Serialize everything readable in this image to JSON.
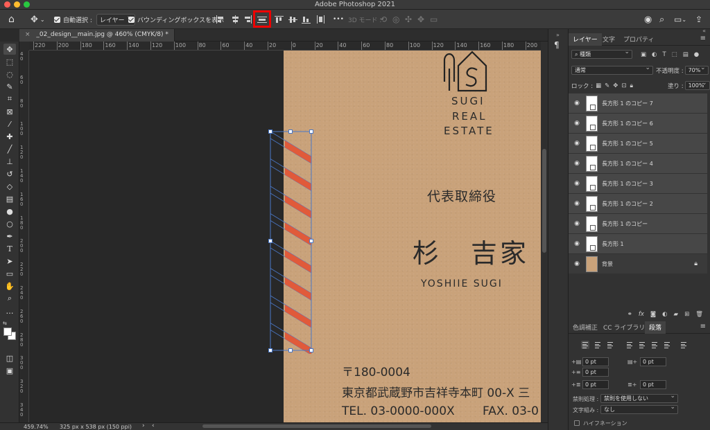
{
  "window": {
    "title": "Adobe Photoshop 2021"
  },
  "options_bar": {
    "auto_select_label": "自動選択 :",
    "auto_select_value": "レイヤー",
    "bounding_box_label": "バウンディングボックスを表示",
    "mode_3d_label": "3D モード :",
    "more_label": "•••"
  },
  "document": {
    "tab_title": "_02_design__main.jpg @ 460% (CMYK/8) *"
  },
  "ruler": {
    "h_labels": [
      "220",
      "200",
      "180",
      "160",
      "140",
      "120",
      "100",
      "80",
      "60",
      "40",
      "20",
      "0",
      "20",
      "40",
      "60",
      "80",
      "100",
      "120",
      "140",
      "160",
      "180",
      "200"
    ],
    "v_labels": [
      "4 0",
      "6 0",
      "8 0",
      "1 0 0",
      "1 2 0",
      "1 4 0",
      "1 6 0",
      "1 8 0",
      "2 0 0",
      "2 2 0",
      "2 4 0",
      "2 6 0",
      "2 8 0",
      "3 0 0",
      "3 2 0",
      "3 4 0"
    ]
  },
  "card": {
    "logo_line1": "SUGI",
    "logo_line2": "REAL",
    "logo_line3": "ESTATE",
    "role": "代表取締役",
    "name": "杉　吉家",
    "name_romaji": "YOSHIIE SUGI",
    "postal": "〒180-0004",
    "address": "東京都武蔵野市吉祥寺本町 00-X 三",
    "tel": "TEL. 03-0000-000X",
    "fax": "FAX. 03-0",
    "stripe_color": "#e05a3a",
    "background_color": "#c9a27a"
  },
  "status_bar": {
    "zoom": "459.74%",
    "doc_info": "325 px x 538 px (150 ppi)"
  },
  "panel": {
    "tabs": [
      "レイヤー",
      "文字",
      "プロパティ"
    ],
    "filter_kind": "種類",
    "blend_mode": "通常",
    "opacity_label": "不透明度 :",
    "opacity_value": "70%",
    "lock_label": "ロック :",
    "fill_label": "塗り :",
    "fill_value": "100%",
    "layers": [
      {
        "name": "長方形 1 のコピー 7"
      },
      {
        "name": "長方形 1 のコピー 6"
      },
      {
        "name": "長方形 1 のコピー 5"
      },
      {
        "name": "長方形 1 のコピー 4"
      },
      {
        "name": "長方形 1 のコピー 3"
      },
      {
        "name": "長方形 1 のコピー 2"
      },
      {
        "name": "長方形 1 のコピー"
      },
      {
        "name": "長方形 1"
      },
      {
        "name": "背景"
      }
    ],
    "bottom_tabs": [
      "色調補正",
      "CC ライブラリ",
      "段落"
    ],
    "para": {
      "indent_left": "0 pt",
      "indent_right": "0 pt",
      "indent_first": "0 pt",
      "space_before": "0 pt",
      "space_after": "0 pt",
      "kinsoku_label": "禁則処理 :",
      "kinsoku_value": "禁則を使用しない",
      "mojikumi_label": "文字組み :",
      "mojikumi_value": "なし",
      "hyphenation_label": "ハイフネーション"
    }
  }
}
